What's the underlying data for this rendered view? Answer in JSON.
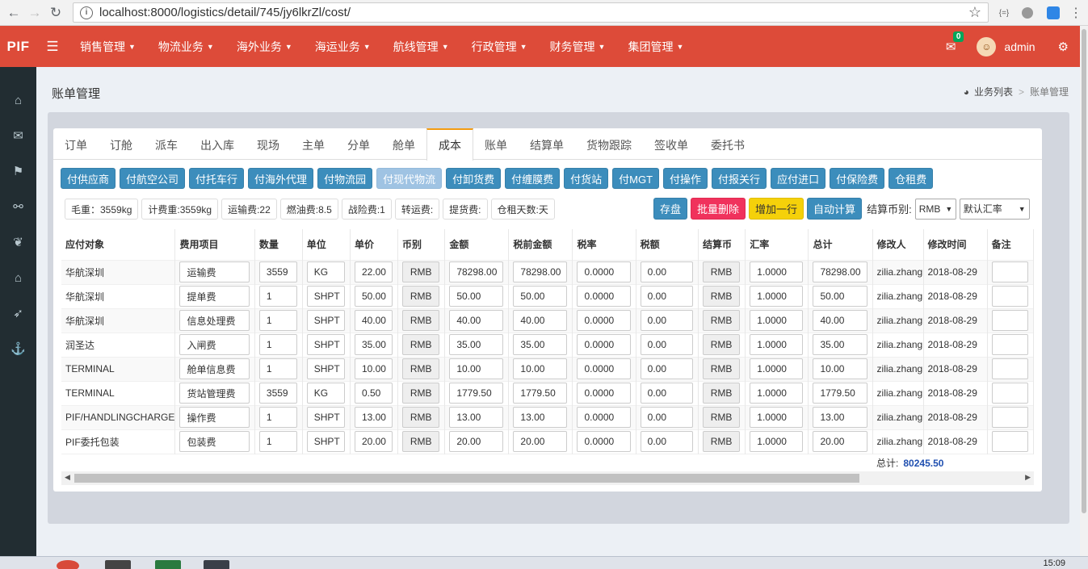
{
  "browser": {
    "url": "localhost:8000/logistics/detail/745/jy6lkrZl/cost/",
    "back_icon": "←",
    "forward_icon": "→",
    "reload_icon": "↻",
    "info_icon": "i",
    "star_icon": "☆",
    "ext1": "{=}"
  },
  "topbar": {
    "logo": "PIF",
    "menu": [
      "销售管理",
      "物流业务",
      "海外业务",
      "海运业务",
      "航线管理",
      "行政管理",
      "财务管理",
      "集团管理"
    ],
    "mail_count": "0",
    "username": "admin"
  },
  "page": {
    "title": "账单管理",
    "breadcrumb": [
      "业务列表",
      "账单管理"
    ]
  },
  "tabs": [
    "订单",
    "订舱",
    "派车",
    "出入库",
    "现场",
    "主单",
    "分单",
    "舱单",
    "成本",
    "账单",
    "结算单",
    "货物跟踪",
    "签收单",
    "委托书"
  ],
  "active_tab": "成本",
  "pay_buttons": [
    "付供应商",
    "付航空公司",
    "付托车行",
    "付海外代理",
    "付物流园",
    "付现代物流",
    "付卸货费",
    "付缠膜费",
    "付货站",
    "付MGT",
    "付操作",
    "付报关行",
    "应付进口",
    "付保险费",
    "仓租费"
  ],
  "selected_pay_button": "付现代物流",
  "info_chips": [
    "毛重：3559kg",
    "计费重:3559kg",
    "运输费:22",
    "燃油费:8.5",
    "战险费:1",
    "转运费:",
    "提货费:",
    "仓租天数:天"
  ],
  "actions": {
    "save": "存盘",
    "batch_delete": "批量删除",
    "add_row": "增加一行",
    "auto_calc": "自动计算",
    "currency_label": "结算币别:",
    "currency_value": "RMB",
    "rate_value": "默认汇率"
  },
  "table": {
    "headers": [
      "应付对象",
      "费用项目",
      "数量",
      "单位",
      "单价",
      "币别",
      "金额",
      "税前金额",
      "税率",
      "税额",
      "结算币",
      "汇率",
      "总计",
      "修改人",
      "修改时间",
      "备注"
    ],
    "rows": [
      {
        "payee": "华航深圳",
        "item": "运输费",
        "qty": "3559",
        "unit": "KG",
        "price": "22.00",
        "cur": "RMB",
        "amount": "78298.00",
        "pretax": "78298.00",
        "rate": "0.0000",
        "tax": "0.00",
        "settle": "RMB",
        "fx": "1.0000",
        "total": "78298.00",
        "user": "zilia.zhang",
        "time": "2018-08-29"
      },
      {
        "payee": "华航深圳",
        "item": "提单费",
        "qty": "1",
        "unit": "SHPT",
        "price": "50.00",
        "cur": "RMB",
        "amount": "50.00",
        "pretax": "50.00",
        "rate": "0.0000",
        "tax": "0.00",
        "settle": "RMB",
        "fx": "1.0000",
        "total": "50.00",
        "user": "zilia.zhang",
        "time": "2018-08-29"
      },
      {
        "payee": "华航深圳",
        "item": "信息处理费",
        "qty": "1",
        "unit": "SHPT",
        "price": "40.00",
        "cur": "RMB",
        "amount": "40.00",
        "pretax": "40.00",
        "rate": "0.0000",
        "tax": "0.00",
        "settle": "RMB",
        "fx": "1.0000",
        "total": "40.00",
        "user": "zilia.zhang",
        "time": "2018-08-29"
      },
      {
        "payee": "润圣达",
        "item": "入闸费",
        "qty": "1",
        "unit": "SHPT",
        "price": "35.00",
        "cur": "RMB",
        "amount": "35.00",
        "pretax": "35.00",
        "rate": "0.0000",
        "tax": "0.00",
        "settle": "RMB",
        "fx": "1.0000",
        "total": "35.00",
        "user": "zilia.zhang",
        "time": "2018-08-29"
      },
      {
        "payee": "TERMINAL",
        "item": "舱单信息费",
        "qty": "1",
        "unit": "SHPT",
        "price": "10.00",
        "cur": "RMB",
        "amount": "10.00",
        "pretax": "10.00",
        "rate": "0.0000",
        "tax": "0.00",
        "settle": "RMB",
        "fx": "1.0000",
        "total": "10.00",
        "user": "zilia.zhang",
        "time": "2018-08-29"
      },
      {
        "payee": "TERMINAL",
        "item": "货站管理费",
        "qty": "3559",
        "unit": "KG",
        "price": "0.50",
        "cur": "RMB",
        "amount": "1779.50",
        "pretax": "1779.50",
        "rate": "0.0000",
        "tax": "0.00",
        "settle": "RMB",
        "fx": "1.0000",
        "total": "1779.50",
        "user": "zilia.zhang",
        "time": "2018-08-29"
      },
      {
        "payee": "PIF/HANDLINGCHARGE",
        "item": "操作费",
        "qty": "1",
        "unit": "SHPT",
        "price": "13.00",
        "cur": "RMB",
        "amount": "13.00",
        "pretax": "13.00",
        "rate": "0.0000",
        "tax": "0.00",
        "settle": "RMB",
        "fx": "1.0000",
        "total": "13.00",
        "user": "zilia.zhang",
        "time": "2018-08-29"
      },
      {
        "payee": "PIF委托包装",
        "item": "包装费",
        "qty": "1",
        "unit": "SHPT",
        "price": "20.00",
        "cur": "RMB",
        "amount": "20.00",
        "pretax": "20.00",
        "rate": "0.0000",
        "tax": "0.00",
        "settle": "RMB",
        "fx": "1.0000",
        "total": "20.00",
        "user": "zilia.zhang",
        "time": "2018-08-29"
      }
    ],
    "total_label": "总计:",
    "total_value": "80245.50"
  },
  "taskbar": {
    "clock": "15:09"
  },
  "colors": {
    "topbar": "#dd4b39",
    "sidebar": "#222d32",
    "primary": "#3c8dbc",
    "danger": "#f0325c",
    "warning": "#f5d10a",
    "tab_active": "#f39c12",
    "total_value": "#1f4fb0"
  },
  "icons": {
    "sidebar": [
      "home-icon",
      "envelope-icon",
      "flag-icon",
      "link-icon",
      "leaf-icon",
      "bank-icon",
      "rocket-icon",
      "anchor-icon"
    ]
  }
}
